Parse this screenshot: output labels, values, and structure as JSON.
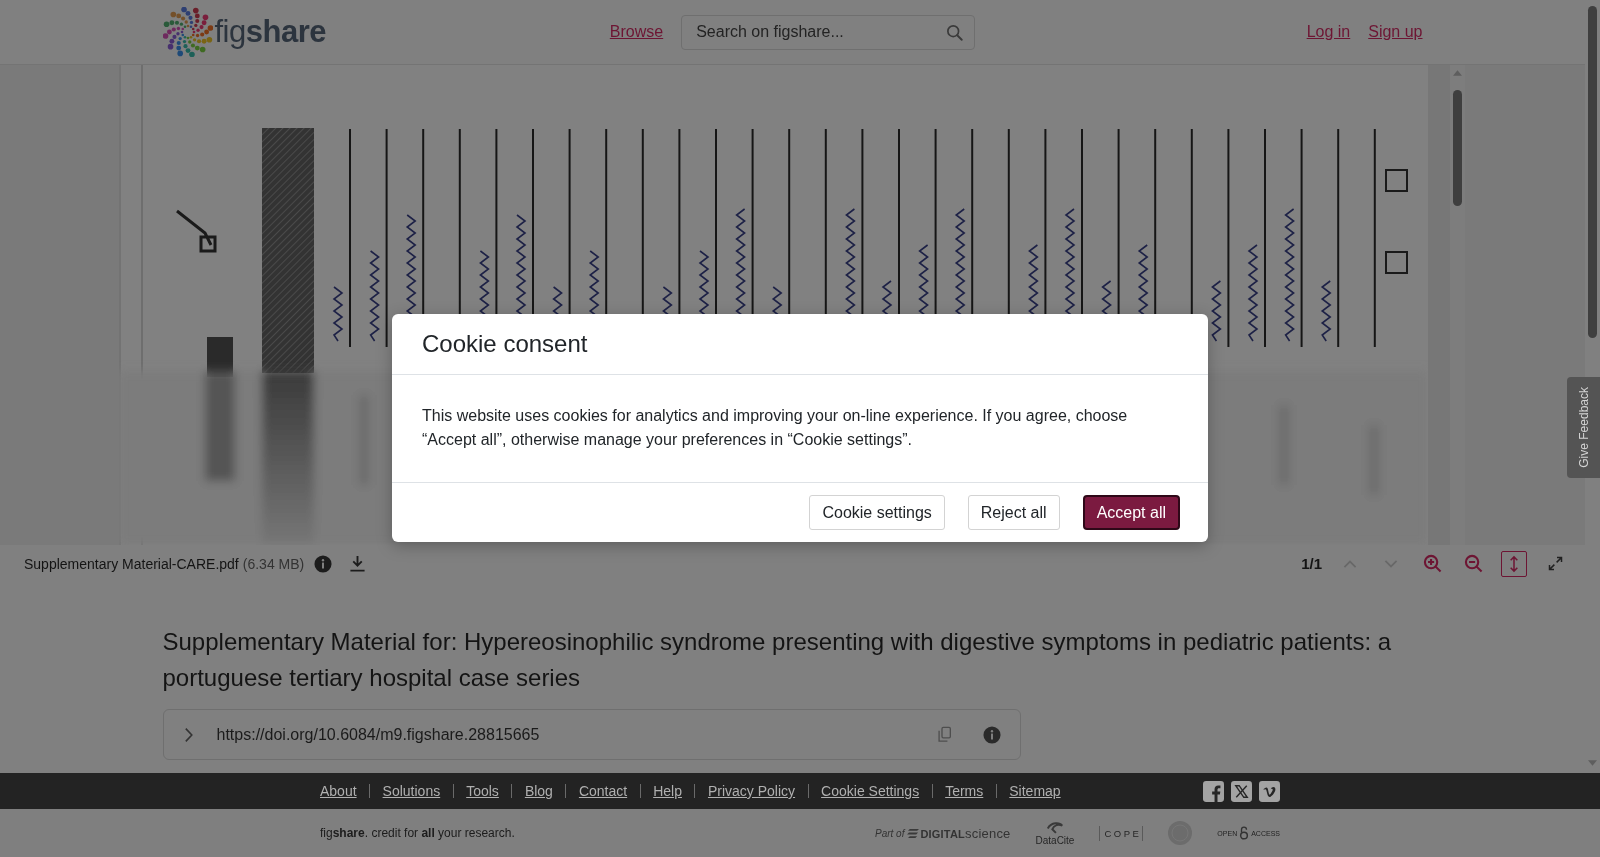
{
  "header": {
    "logo": "fig**share**",
    "nav": [
      "Browse"
    ],
    "search": {
      "placeholder": "Search on figshare..."
    },
    "account_links": [
      "Log in",
      "Sign up"
    ]
  },
  "viewer": {
    "file_name": "Supplementary Material-CARE.pdf",
    "file_size": "(6.34 MB)",
    "page_indicator": "1/1",
    "page_nav": [
      {
        "kind": "previous",
        "disabled": true
      },
      {
        "kind": "next",
        "disabled": true
      }
    ],
    "tools": [
      {
        "kind": "zoom-in",
        "on": false
      },
      {
        "kind": "zoom-out",
        "on": false
      },
      {
        "kind": "fit-height",
        "on": true
      },
      {
        "kind": "fullscreen",
        "on": false
      }
    ]
  },
  "title": "Supplementary Material for: Hypereosinophilic syndrome presenting with digestive symptoms in pediatric patients: a portuguese tertiary hospital case series",
  "doi": {
    "url": "https://doi.org/10.6084/m9.figshare.28815665"
  },
  "footer": {
    "links": [
      "About",
      "Solutions",
      "Tools",
      "Blog",
      "Contact",
      "Help",
      "Privacy Policy",
      "Cookie Settings",
      "Terms",
      "Sitemap"
    ],
    "tagline": "fig**share**. credit for **all** your research.",
    "partners": [
      {
        "kind": "digital-science",
        "lead": "Part of",
        "name": "**DIGITAL**science"
      },
      {
        "kind": "datacite",
        "name": "DataCite"
      },
      {
        "kind": "cope",
        "name": "COPE"
      },
      {
        "kind": "seal"
      },
      {
        "kind": "open-access",
        "words": [
          "OPEN",
          "ACCESS"
        ]
      }
    ]
  },
  "feedback_tab": "Give Feedback",
  "cookie_dialog": {
    "title": "Cookie consent",
    "message": "This website uses cookies for analytics and improving your on-line experience. If you agree, choose “Accept all”, otherwise manage your preferences in “Cookie settings”.",
    "buttons": [
      {
        "label": "Cookie settings",
        "kind": "secondary",
        "focused": false
      },
      {
        "label": "Reject all",
        "kind": "secondary",
        "focused": false
      },
      {
        "label": "Accept all",
        "kind": "primary",
        "focused": true
      }
    ]
  }
}
